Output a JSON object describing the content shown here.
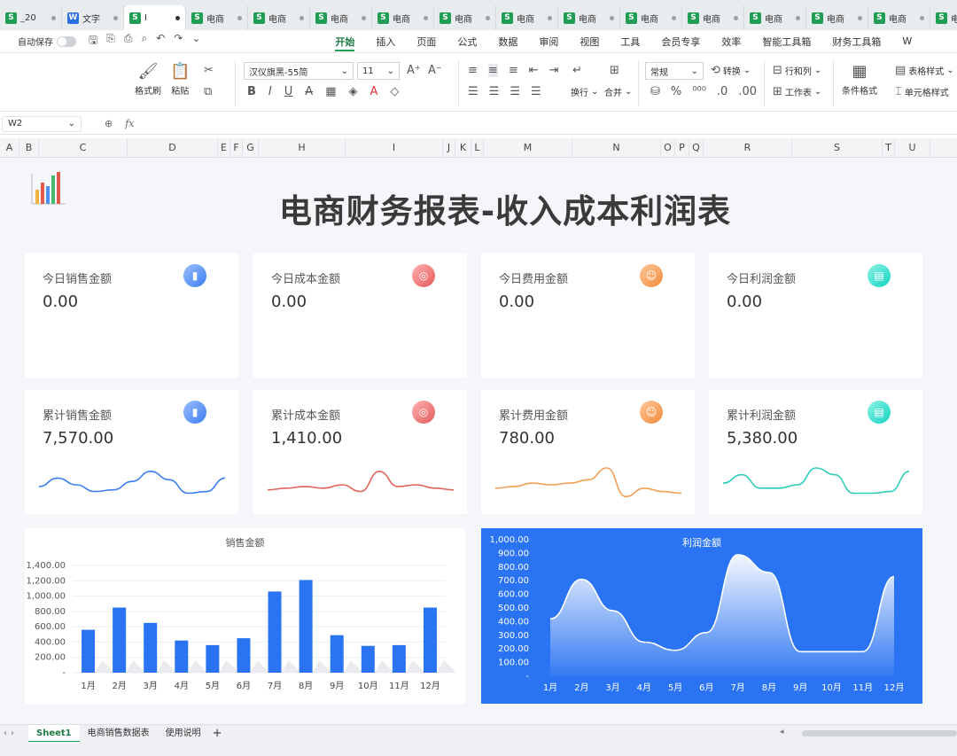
{
  "tabs": [
    {
      "label": "_20",
      "type": "S",
      "active": false
    },
    {
      "label": "文字",
      "type": "W",
      "active": false
    },
    {
      "label": "I",
      "type": "S",
      "active": true
    },
    {
      "label": "电商",
      "type": "S",
      "active": false
    },
    {
      "label": "电商",
      "type": "S",
      "active": false
    },
    {
      "label": "电商",
      "type": "S",
      "active": false
    },
    {
      "label": "电商",
      "type": "S",
      "active": false
    },
    {
      "label": "电商",
      "type": "S",
      "active": false
    },
    {
      "label": "电商",
      "type": "S",
      "active": false
    },
    {
      "label": "电商",
      "type": "S",
      "active": false
    },
    {
      "label": "电商",
      "type": "S",
      "active": false
    },
    {
      "label": "电商",
      "type": "S",
      "active": false
    },
    {
      "label": "电商",
      "type": "S",
      "active": false
    },
    {
      "label": "电商",
      "type": "S",
      "active": false
    },
    {
      "label": "电商",
      "type": "S",
      "active": false
    },
    {
      "label": "电商",
      "type": "S",
      "active": false
    }
  ],
  "menubar": {
    "autosave": "自动保存",
    "items": [
      "开始",
      "插入",
      "页面",
      "公式",
      "数据",
      "审阅",
      "视图",
      "工具",
      "会员专享",
      "效率",
      "智能工具箱",
      "财务工具箱",
      "W"
    ]
  },
  "ribbon": {
    "format_painter": "格式刷",
    "paste": "粘贴",
    "font_name": "汉仪旗黑-55简",
    "font_size": "11",
    "wrap": "换行",
    "merge": "合并",
    "number_format": "常规",
    "convert": "转换",
    "rows_cols": "行和列",
    "worksheet": "工作表",
    "cond_format": "条件格式",
    "table_style": "表格样式",
    "cell_style": "单元格样式"
  },
  "formula_bar": {
    "cell_ref": "W2",
    "fx": "fx"
  },
  "columns": [
    "A",
    "B",
    "C",
    "D",
    "E",
    "F",
    "G",
    "H",
    "I",
    "J",
    "K",
    "L",
    "M",
    "N",
    "O",
    "P",
    "Q",
    "R",
    "S",
    "T",
    "U"
  ],
  "dashboard": {
    "title": "电商财务报表-收入成本利润表",
    "today_cards": [
      {
        "label": "今日销售金额",
        "value": "0.00",
        "icon": "bar-chart-icon",
        "color": "blue"
      },
      {
        "label": "今日成本金额",
        "value": "0.00",
        "icon": "target-icon",
        "color": "red"
      },
      {
        "label": "今日费用金额",
        "value": "0.00",
        "icon": "users-icon",
        "color": "orange"
      },
      {
        "label": "今日利润金额",
        "value": "0.00",
        "icon": "document-icon",
        "color": "cyan"
      }
    ],
    "total_cards": [
      {
        "label": "累计销售金额",
        "value": "7,570.00",
        "icon": "bar-chart-icon",
        "color": "blue",
        "line_color": "#3a7ef0"
      },
      {
        "label": "累计成本金额",
        "value": "1,410.00",
        "icon": "target-icon",
        "color": "red",
        "line_color": "#e2645a"
      },
      {
        "label": "累计费用金额",
        "value": "780.00",
        "icon": "users-icon",
        "color": "orange",
        "line_color": "#f1a055"
      },
      {
        "label": "累计利润金额",
        "value": "5,380.00",
        "icon": "document-icon",
        "color": "cyan",
        "line_color": "#2fcdb9"
      }
    ]
  },
  "chart_data": [
    {
      "type": "bar",
      "title": "销售金额",
      "categories": [
        "1月",
        "2月",
        "3月",
        "4月",
        "5月",
        "6月",
        "7月",
        "8月",
        "9月",
        "10月",
        "11月",
        "12月"
      ],
      "values": [
        560,
        850,
        650,
        420,
        360,
        450,
        1060,
        1210,
        490,
        350,
        360,
        850
      ],
      "ylim": [
        0,
        1400
      ],
      "yticks": [
        "-",
        "200.00",
        "400.00",
        "600.00",
        "800.00",
        "1,000.00",
        "1,200.00",
        "1,400.00"
      ],
      "bar_color": "#2a73f2",
      "grid": true
    },
    {
      "type": "area",
      "title": "利润金额",
      "categories": [
        "1月",
        "2月",
        "3月",
        "4月",
        "5月",
        "6月",
        "7月",
        "8月",
        "9月",
        "10月",
        "11月",
        "12月"
      ],
      "values": [
        420,
        710,
        480,
        250,
        190,
        320,
        890,
        760,
        180,
        180,
        180,
        730
      ],
      "ylim": [
        0,
        1000
      ],
      "yticks": [
        "-",
        "100.00",
        "200.00",
        "300.00",
        "400.00",
        "500.00",
        "600.00",
        "700.00",
        "800.00",
        "900.00",
        "1,000.00"
      ],
      "background": "#2a73f2",
      "grid": false
    }
  ],
  "sheet_tabs": [
    "Sheet1",
    "电商销售数据表",
    "使用说明"
  ],
  "sparklines": [
    [
      0.55,
      0.3,
      0.5,
      0.7,
      0.65,
      0.4,
      0.1,
      0.35,
      0.75,
      0.7,
      0.3
    ],
    [
      0.65,
      0.6,
      0.55,
      0.6,
      0.5,
      0.7,
      0.1,
      0.55,
      0.5,
      0.6,
      0.65
    ],
    [
      0.6,
      0.55,
      0.45,
      0.5,
      0.45,
      0.35,
      0.0,
      0.85,
      0.6,
      0.7,
      0.75
    ],
    [
      0.45,
      0.2,
      0.6,
      0.6,
      0.5,
      0.0,
      0.2,
      0.75,
      0.75,
      0.7,
      0.1
    ]
  ]
}
